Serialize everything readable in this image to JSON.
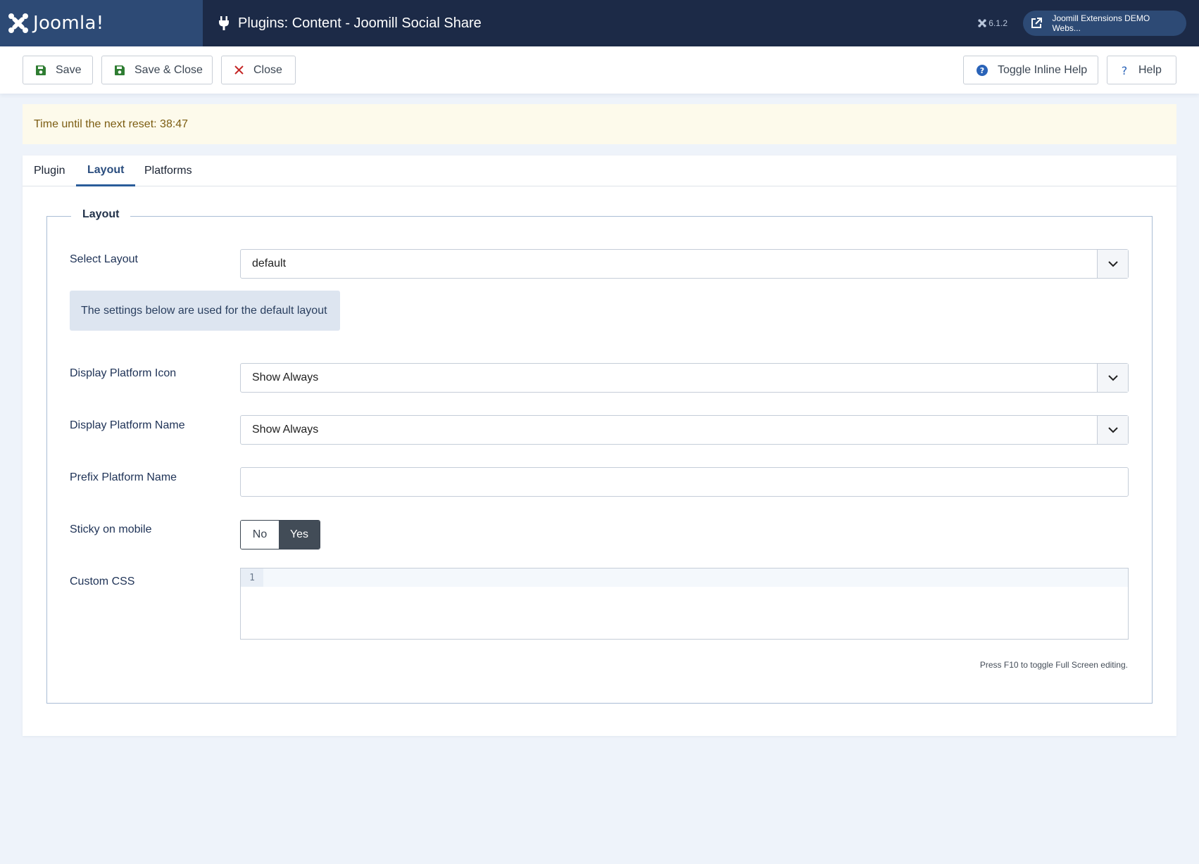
{
  "header": {
    "logo_text": "Joomla!",
    "title": "Plugins: Content - Joomill Social Share",
    "version": "6.1.2",
    "site_button": "Joomill Extensions DEMO Webs..."
  },
  "toolbar": {
    "save": "Save",
    "save_close": "Save & Close",
    "close": "Close",
    "toggle_help": "Toggle Inline Help",
    "help": "Help"
  },
  "alert": {
    "text": "Time until the next reset: 38:47"
  },
  "tabs": [
    {
      "label": "Plugin"
    },
    {
      "label": "Layout"
    },
    {
      "label": "Platforms"
    }
  ],
  "fieldset": {
    "legend": "Layout",
    "select_layout": {
      "label": "Select Layout",
      "value": "default"
    },
    "info": "The settings below are used for the default layout",
    "platform_icon": {
      "label": "Display Platform Icon",
      "value": "Show Always"
    },
    "platform_name": {
      "label": "Display Platform Name",
      "value": "Show Always"
    },
    "prefix_name": {
      "label": "Prefix Platform Name",
      "value": ""
    },
    "sticky": {
      "label": "Sticky on mobile",
      "no": "No",
      "yes": "Yes"
    },
    "custom_css": {
      "label": "Custom CSS",
      "line_number": "1"
    },
    "hint": "Press F10 to toggle Full Screen editing."
  },
  "colors": {
    "header_bg": "#1c2a47",
    "logo_bg": "#2d4a75",
    "active_tab": "#2a5c9a",
    "save_icon": "#2f7d32",
    "close_icon": "#c52827",
    "help_icon": "#2a63b8"
  }
}
